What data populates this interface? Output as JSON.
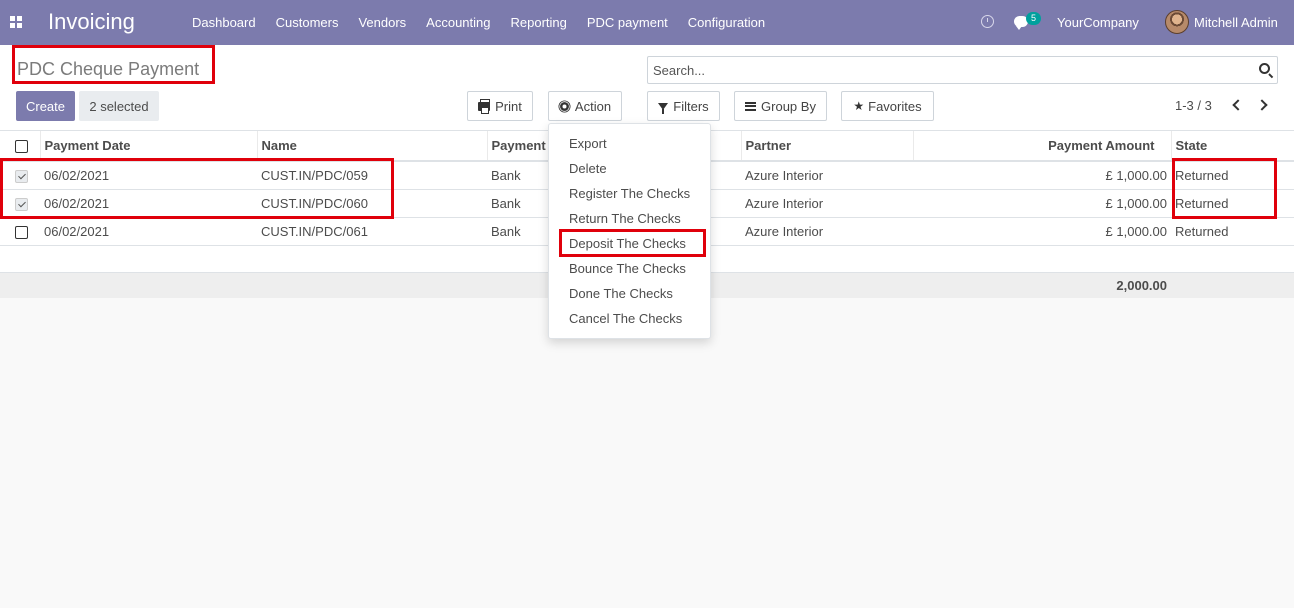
{
  "navbar": {
    "brand": "Invoicing",
    "menu": [
      "Dashboard",
      "Customers",
      "Vendors",
      "Accounting",
      "Reporting",
      "PDC payment",
      "Configuration"
    ],
    "chat_count": "5",
    "company": "YourCompany",
    "user": "Mitchell Admin"
  },
  "control": {
    "title": "PDC Cheque Payment",
    "create_label": "Create",
    "selected_label": "2 selected",
    "print_label": "Print",
    "action_label": "Action",
    "search_placeholder": "Search...",
    "filters_label": "Filters",
    "groupby_label": "Group By",
    "favorites_label": "Favorites",
    "pager": "1-3 / 3"
  },
  "table": {
    "columns": [
      "Payment Date",
      "Name",
      "Payment",
      "Partner",
      "Payment Amount",
      "State"
    ],
    "rows": [
      {
        "checked": true,
        "date": "06/02/2021",
        "name": "CUST.IN/PDC/059",
        "payment": "Bank",
        "partner": "Azure Interior",
        "amount": "£ 1,000.00",
        "state": "Returned"
      },
      {
        "checked": true,
        "date": "06/02/2021",
        "name": "CUST.IN/PDC/060",
        "payment": "Bank",
        "partner": "Azure Interior",
        "amount": "£ 1,000.00",
        "state": "Returned"
      },
      {
        "checked": false,
        "date": "06/02/2021",
        "name": "CUST.IN/PDC/061",
        "payment": "Bank",
        "partner": "Azure Interior",
        "amount": "£ 1,000.00",
        "state": "Returned"
      }
    ],
    "total": "2,000.00"
  },
  "action_menu": [
    "Export",
    "Delete",
    "Register The Checks",
    "Return The Checks",
    "Deposit The Checks",
    "Bounce The Checks",
    "Done The Checks",
    "Cancel The Checks"
  ],
  "colors": {
    "navbar": "#7c7bad",
    "highlight": "#e0000b"
  }
}
